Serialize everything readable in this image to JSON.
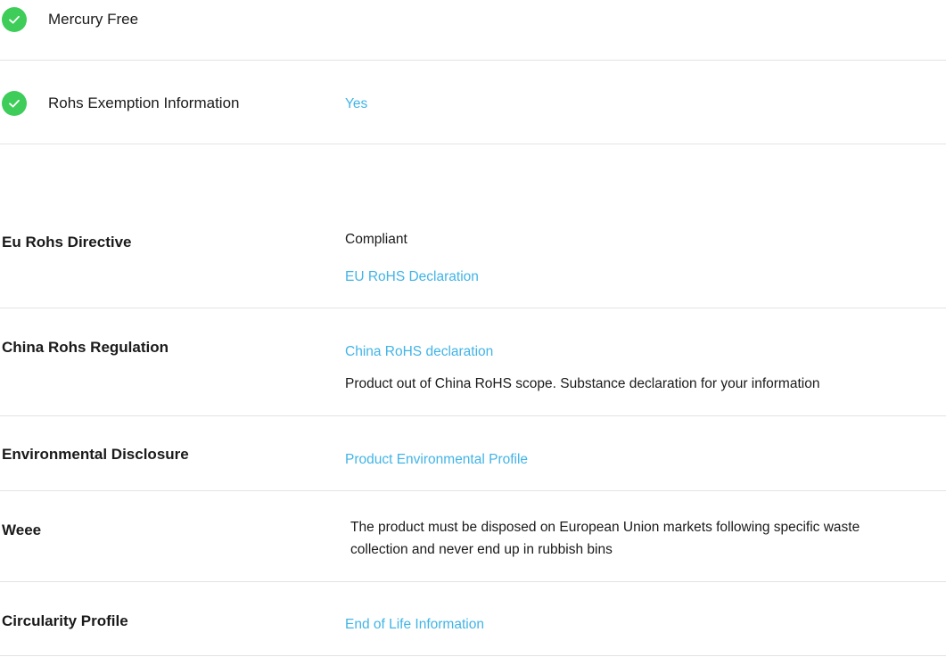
{
  "features": [
    {
      "label": "Mercury Free",
      "value": ""
    },
    {
      "label": "Rohs Exemption Information",
      "value": "Yes"
    }
  ],
  "rows": [
    {
      "label": "Eu Rohs Directive",
      "status": "Compliant",
      "link": "EU RoHS Declaration"
    },
    {
      "label": "China Rohs Regulation",
      "link": "China RoHS declaration",
      "note": "Product out of China RoHS scope. Substance declaration for your information"
    },
    {
      "label": "Environmental Disclosure",
      "link": "Product Environmental Profile"
    },
    {
      "label": "Weee",
      "text_line1": "The product must be disposed on European Union markets following specific waste",
      "text_line2": "collection and never end up in rubbish bins"
    },
    {
      "label": "Circularity Profile",
      "link": "End of Life Information"
    }
  ],
  "colors": {
    "check": "#3dcd58",
    "link": "#42b4e6",
    "divider": "#e3e3e3"
  },
  "icons": {
    "check": "check-circle-icon"
  }
}
